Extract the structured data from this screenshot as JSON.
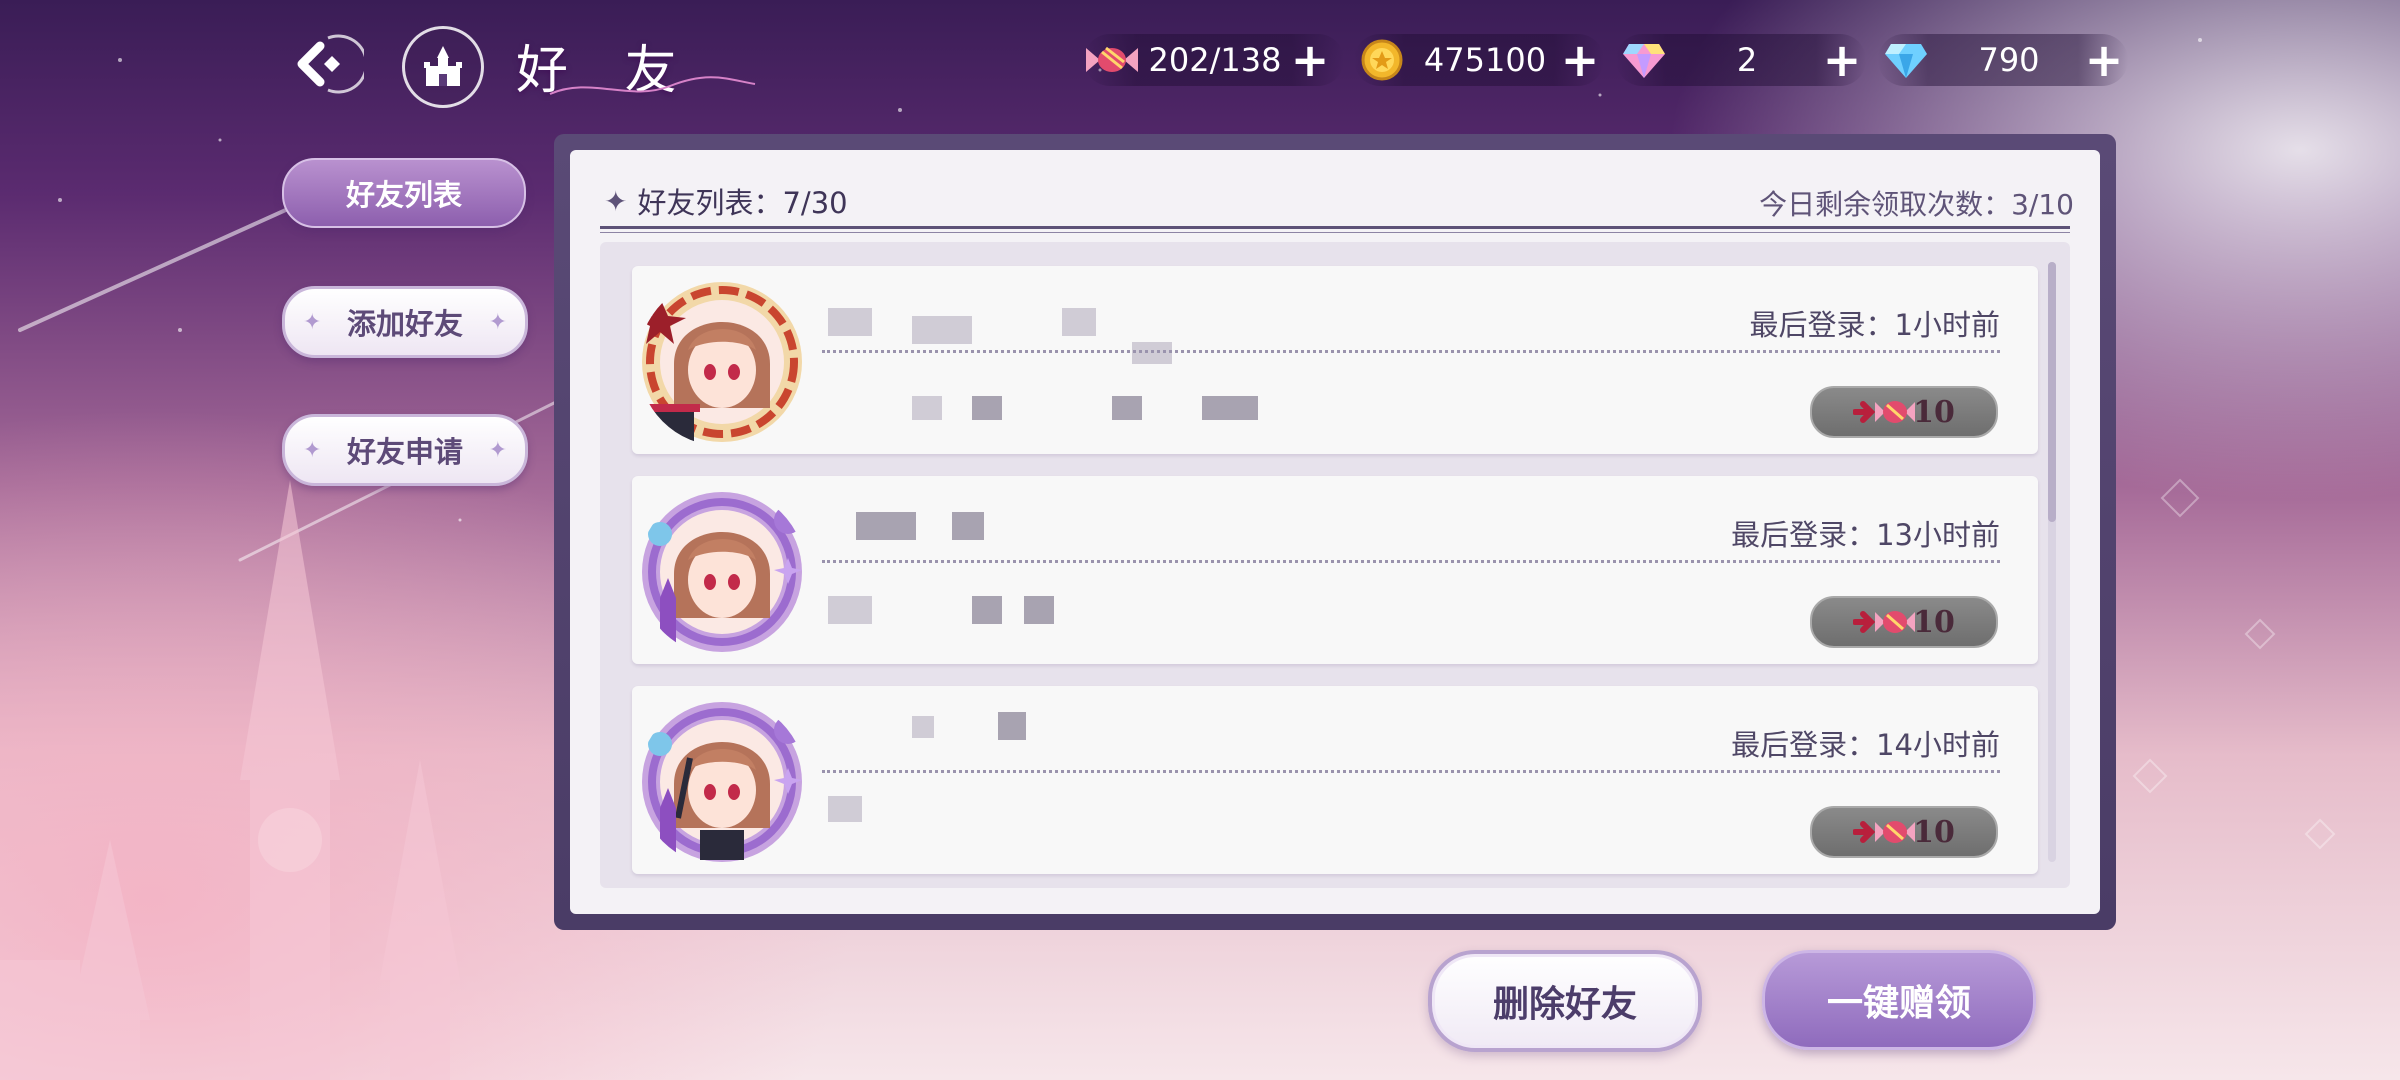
{
  "header": {
    "title": "好 友",
    "back_icon": "back-arrow-icon",
    "home_icon": "castle-home-icon"
  },
  "resources": [
    {
      "name": "candy",
      "icon": "candy-icon",
      "value": "202/138"
    },
    {
      "name": "gold",
      "icon": "gold-coin-icon",
      "value": "475100"
    },
    {
      "name": "rainbow-gem",
      "icon": "rainbow-diamond-icon",
      "value": "2"
    },
    {
      "name": "blue-gem",
      "icon": "blue-diamond-icon",
      "value": "790"
    }
  ],
  "sidebar": {
    "tabs": [
      {
        "label": "好友列表",
        "active": true
      },
      {
        "label": "添加好友",
        "active": false
      },
      {
        "label": "好友申请",
        "active": false
      }
    ]
  },
  "panel": {
    "friend_count": "好友列表：7/30",
    "remaining_claims": "今日剩余领取次数：3/10"
  },
  "friends": [
    {
      "last_login": "最后登录：1小时前",
      "gift_count": "10"
    },
    {
      "last_login": "最后登录：13小时前",
      "gift_count": "10"
    },
    {
      "last_login": "最后登录：14小时前",
      "gift_count": "10"
    }
  ],
  "actions": {
    "delete_label": "删除好友",
    "gift_all_label": "一键赠领"
  },
  "colors": {
    "accent_purple": "#8d5fae",
    "panel_frame": "#4a3c66",
    "gift_button": "#6e6e6e"
  }
}
